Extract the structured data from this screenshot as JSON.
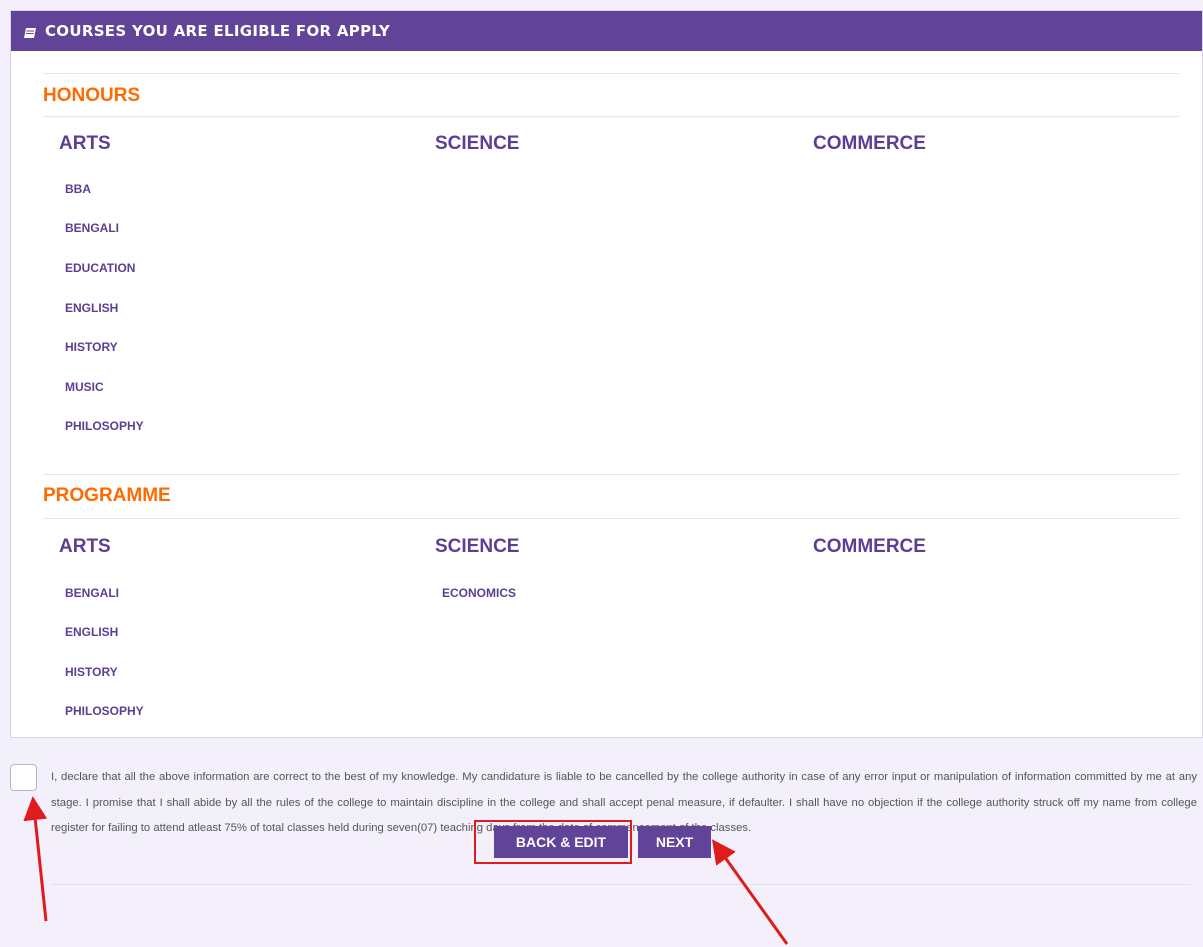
{
  "panel": {
    "title": "COURSES YOU ARE ELIGIBLE FOR APPLY",
    "header_icon": "book-icon"
  },
  "honours": {
    "title": "HONOURS",
    "arts": {
      "label": "ARTS",
      "courses": [
        "BBA",
        "BENGALI",
        "EDUCATION",
        "ENGLISH",
        "HISTORY",
        "MUSIC",
        "PHILOSOPHY"
      ]
    },
    "science": {
      "label": "SCIENCE",
      "courses": []
    },
    "commerce": {
      "label": "COMMERCE",
      "courses": []
    }
  },
  "programme": {
    "title": "PROGRAMME",
    "arts": {
      "label": "ARTS",
      "courses": [
        "BENGALI",
        "ENGLISH",
        "HISTORY",
        "PHILOSOPHY"
      ]
    },
    "science": {
      "label": "SCIENCE",
      "courses": [
        "ECONOMICS"
      ]
    },
    "commerce": {
      "label": "COMMERCE",
      "courses": []
    }
  },
  "declaration": {
    "text": "I, declare that all the above information are correct to the best of my knowledge. My candidature is liable to be cancelled by the college authority in case of any error input or manipulation of information committed by me at any stage. I promise that I shall abide by all the rules of the college to maintain discipline in the college and shall accept penal measure, if defaulter. I shall have no objection if the college authority struck off my name from college register for failing to attend atleast 75% of total classes held during seven(07) teaching days from the date of commencement of the classes.",
    "checked": false
  },
  "buttons": {
    "back_edit": "BACK & EDIT",
    "next": "NEXT"
  },
  "colors": {
    "accent": "#614398",
    "section_title": "#ff6b00",
    "annotation": "#e01b1b"
  }
}
